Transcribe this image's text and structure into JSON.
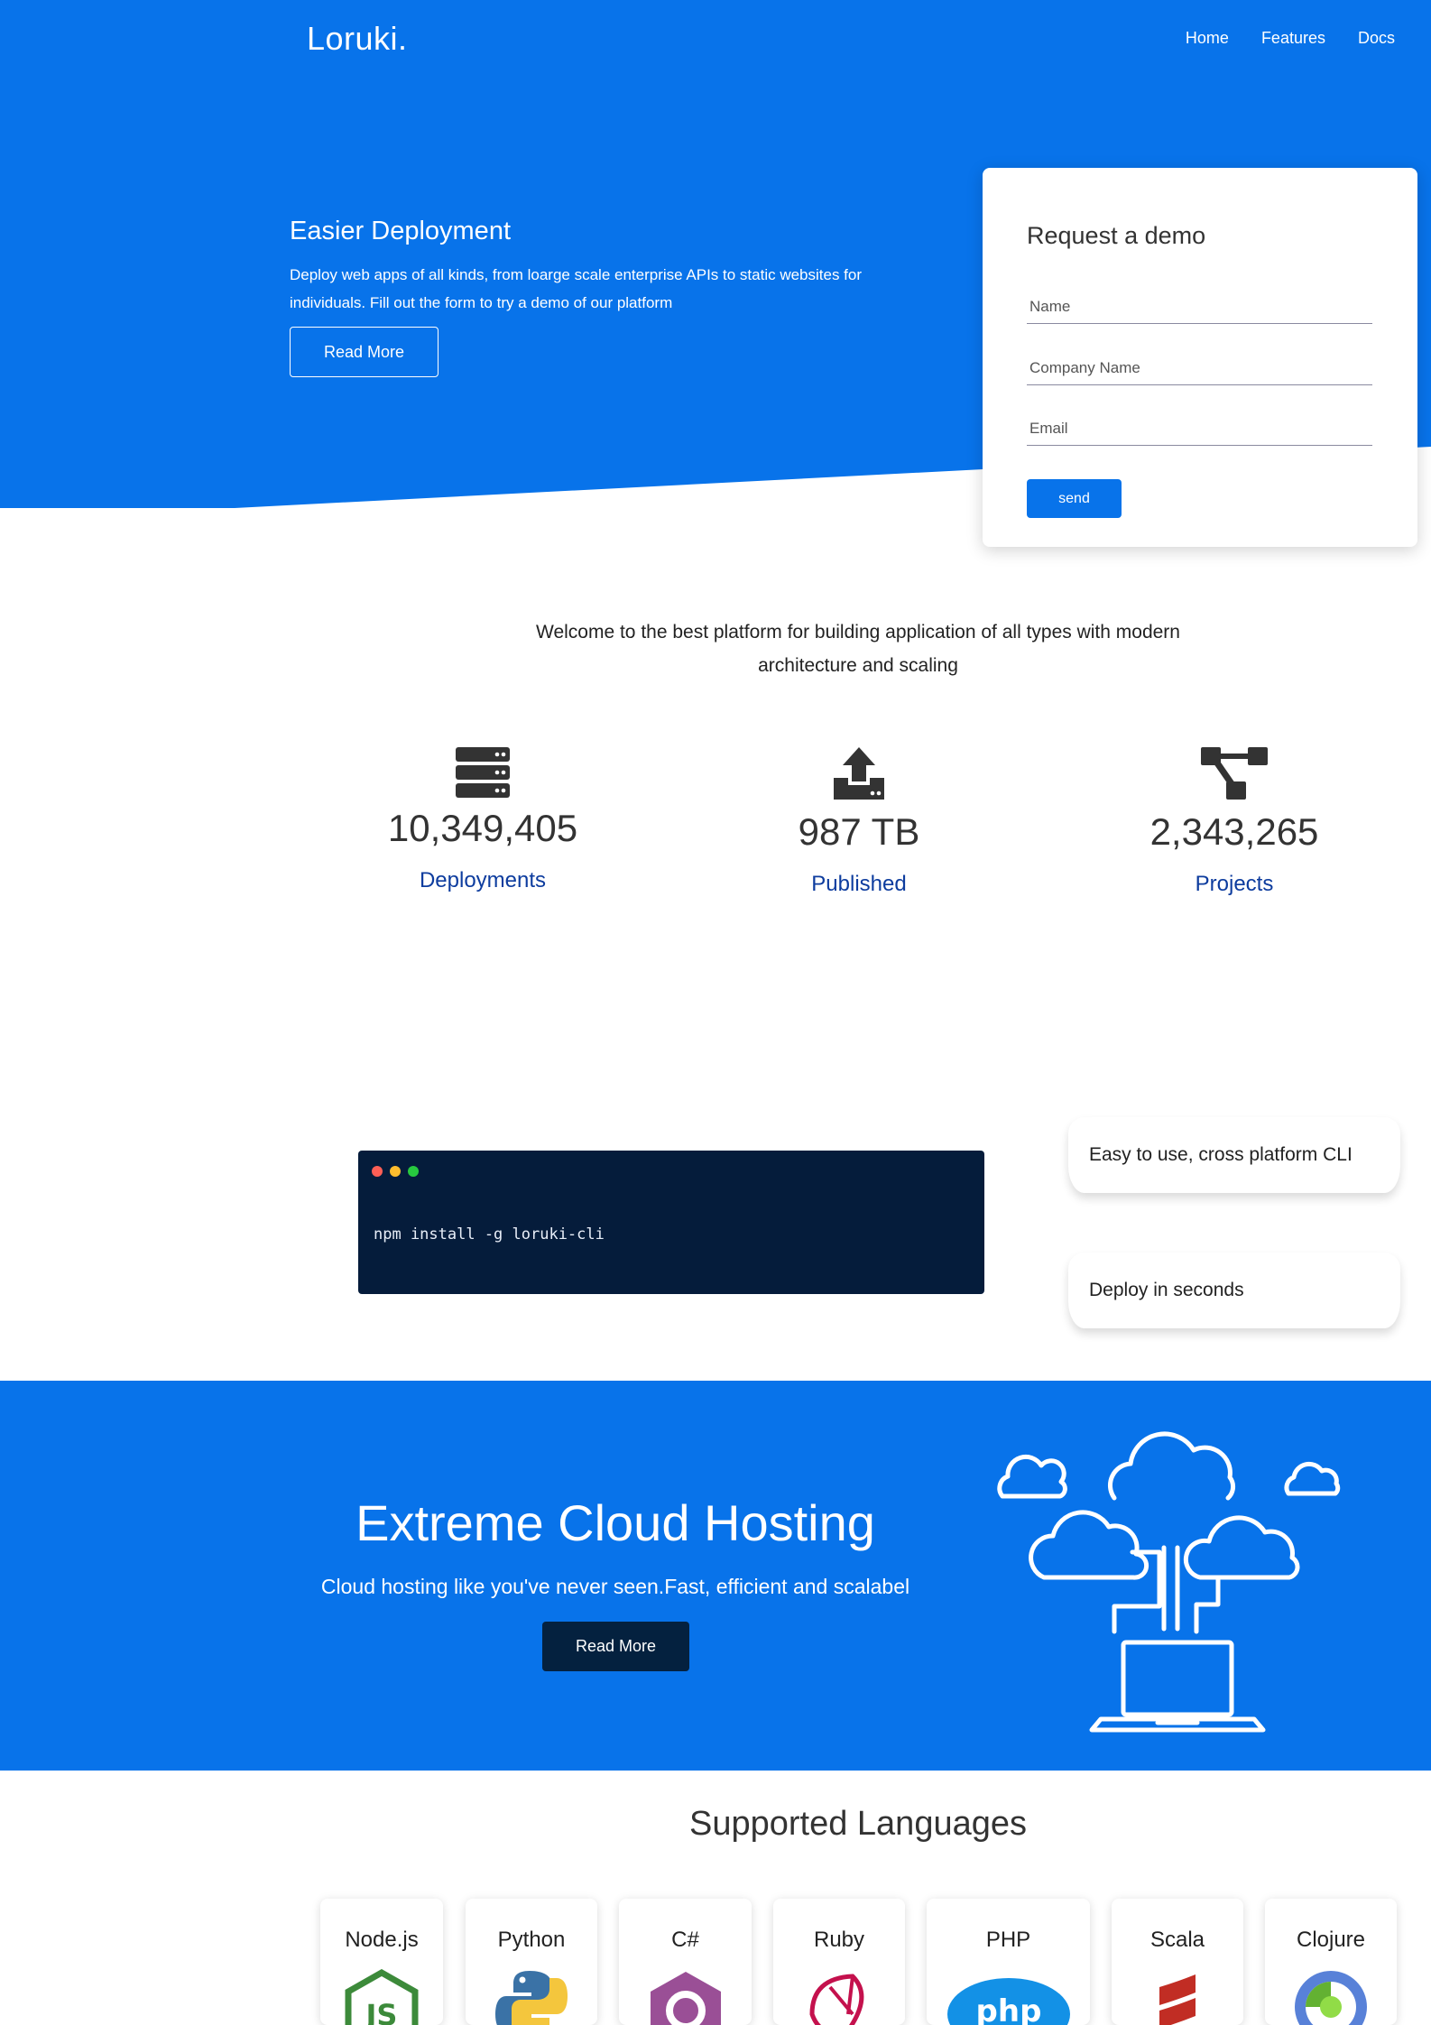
{
  "brand": "Loruki.",
  "nav": {
    "items": [
      "Home",
      "Features",
      "Docs"
    ]
  },
  "hero": {
    "title": "Easier Deployment",
    "description": "Deploy web apps of all kinds, from loarge scale enterprise APIs to static websites for individuals. Fill out the form to try a demo of our platform",
    "button": "Read More"
  },
  "demo_form": {
    "title": "Request a demo",
    "name_placeholder": "Name",
    "company_placeholder": "Company Name",
    "email_placeholder": "Email",
    "submit": "send"
  },
  "welcome": "Welcome to the best platform for building application of all types with modern architecture and scaling",
  "stats": [
    {
      "icon": "server-icon",
      "value": "10,349,405",
      "label": "Deployments"
    },
    {
      "icon": "upload-icon",
      "value": "987 TB",
      "label": "Published"
    },
    {
      "icon": "project-diagram-icon",
      "value": "2,343,265",
      "label": "Projects"
    }
  ],
  "cli": {
    "command": "npm install -g loruki-cli",
    "dot_colors": [
      "#ff5f56",
      "#ffbd2e",
      "#27c93f"
    ],
    "features": [
      "Easy to use, cross platform CLI",
      "Deploy in seconds"
    ]
  },
  "cloud": {
    "title": "Extreme Cloud Hosting",
    "subtitle": "Cloud hosting like you've never seen.Fast, efficient and scalabel",
    "button": "Read More"
  },
  "languages": {
    "title": "Supported Languages",
    "items": [
      "Node.js",
      "Python",
      "C#",
      "Ruby",
      "PHP",
      "Scala",
      "Clojure"
    ]
  },
  "colors": {
    "primary": "#0873ea",
    "dark": "#051c3b",
    "stat_label": "#0d3c9e"
  }
}
